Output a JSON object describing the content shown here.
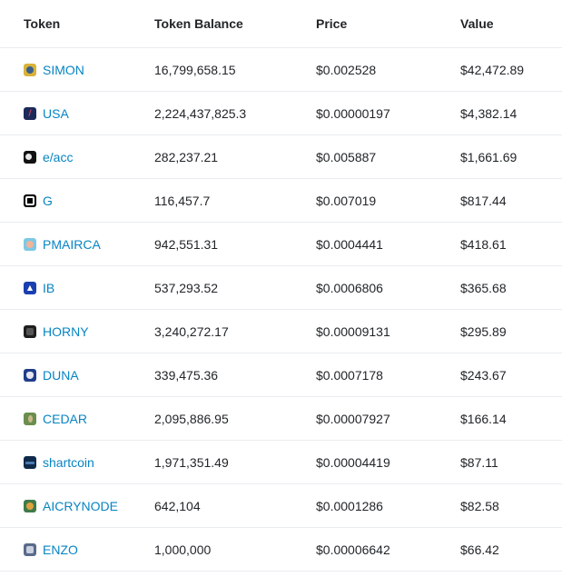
{
  "table": {
    "headers": {
      "token": "Token",
      "balance": "Token Balance",
      "price": "Price",
      "value": "Value"
    },
    "rows": [
      {
        "token": "SIMON",
        "icon": "simon-token-icon",
        "balance": "16,799,658.15",
        "price": "$0.002528",
        "value": "$42,472.89"
      },
      {
        "token": "USA",
        "icon": "usa-token-icon",
        "balance": "2,224,437,825.3",
        "price": "$0.00000197",
        "value": "$4,382.14"
      },
      {
        "token": "e/acc",
        "icon": "eacc-token-icon",
        "balance": "282,237.21",
        "price": "$0.005887",
        "value": "$1,661.69"
      },
      {
        "token": "G",
        "icon": "g-token-icon",
        "balance": "116,457.7",
        "price": "$0.007019",
        "value": "$817.44"
      },
      {
        "token": "PMAIRCA",
        "icon": "pmairca-token-icon",
        "balance": "942,551.31",
        "price": "$0.0004441",
        "value": "$418.61"
      },
      {
        "token": "IB",
        "icon": "ib-token-icon",
        "balance": "537,293.52",
        "price": "$0.0006806",
        "value": "$365.68"
      },
      {
        "token": "HORNY",
        "icon": "horny-token-icon",
        "balance": "3,240,272.17",
        "price": "$0.00009131",
        "value": "$295.89"
      },
      {
        "token": "DUNA",
        "icon": "duna-token-icon",
        "balance": "339,475.36",
        "price": "$0.0007178",
        "value": "$243.67"
      },
      {
        "token": "CEDAR",
        "icon": "cedar-token-icon",
        "balance": "2,095,886.95",
        "price": "$0.00007927",
        "value": "$166.14"
      },
      {
        "token": "shartcoin",
        "icon": "shartcoin-token-icon",
        "balance": "1,971,351.49",
        "price": "$0.00004419",
        "value": "$87.11"
      },
      {
        "token": "AICRYNODE",
        "icon": "aicrynode-token-icon",
        "balance": "642,104",
        "price": "$0.0001286",
        "value": "$82.58"
      },
      {
        "token": "ENZO",
        "icon": "enzo-token-icon",
        "balance": "1,000,000",
        "price": "$0.00006642",
        "value": "$66.42"
      }
    ]
  },
  "colors": {
    "link": "#0784c3",
    "text": "#212529",
    "divider": "#e9ecef"
  }
}
